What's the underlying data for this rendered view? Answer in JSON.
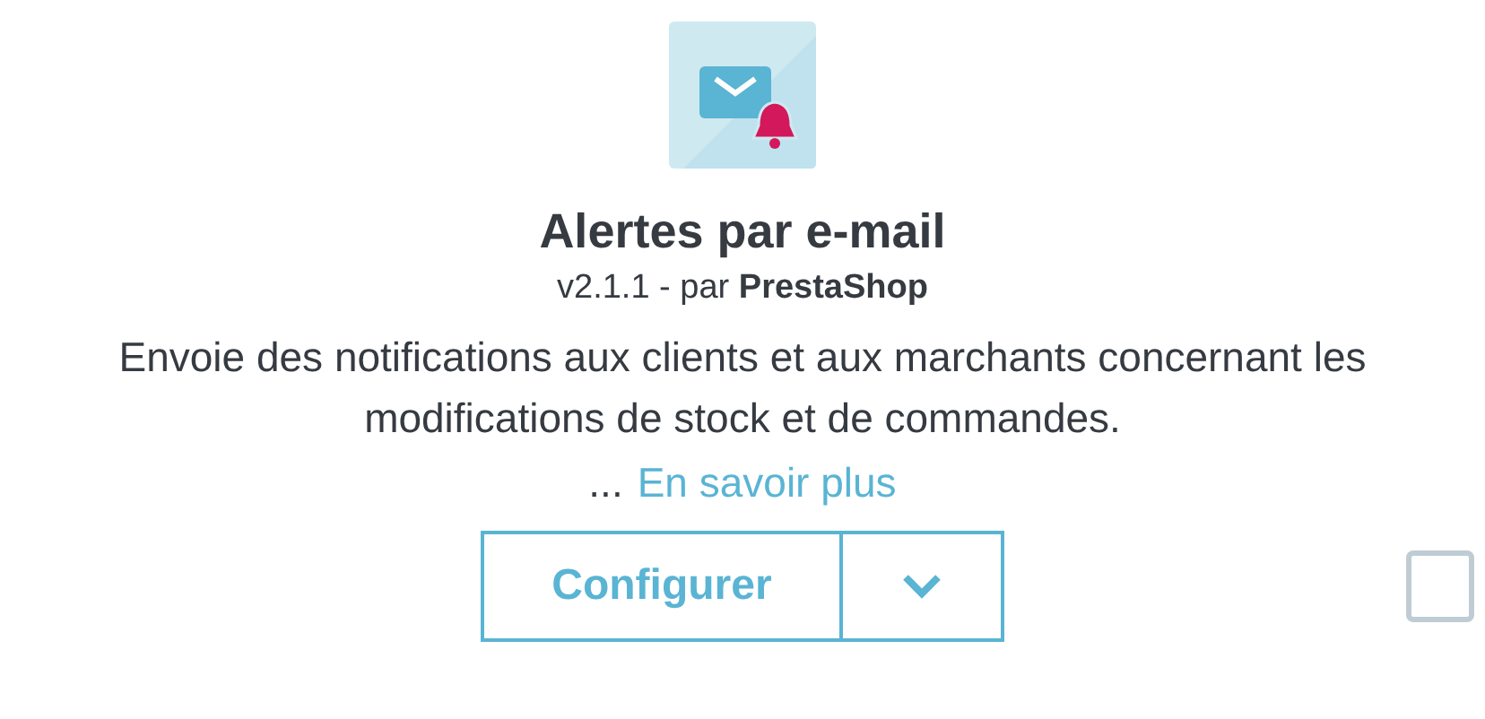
{
  "module": {
    "title": "Alertes par e-mail",
    "version_line": "v2.1.1 - par **PrestaShop**",
    "description": "Envoie des notifications aux clients et aux marchants concernant les modifications de stock et de commandes.",
    "ellipsis": "...",
    "more_link": "En savoir plus",
    "configure_button": "Configurer",
    "selected": false
  }
}
